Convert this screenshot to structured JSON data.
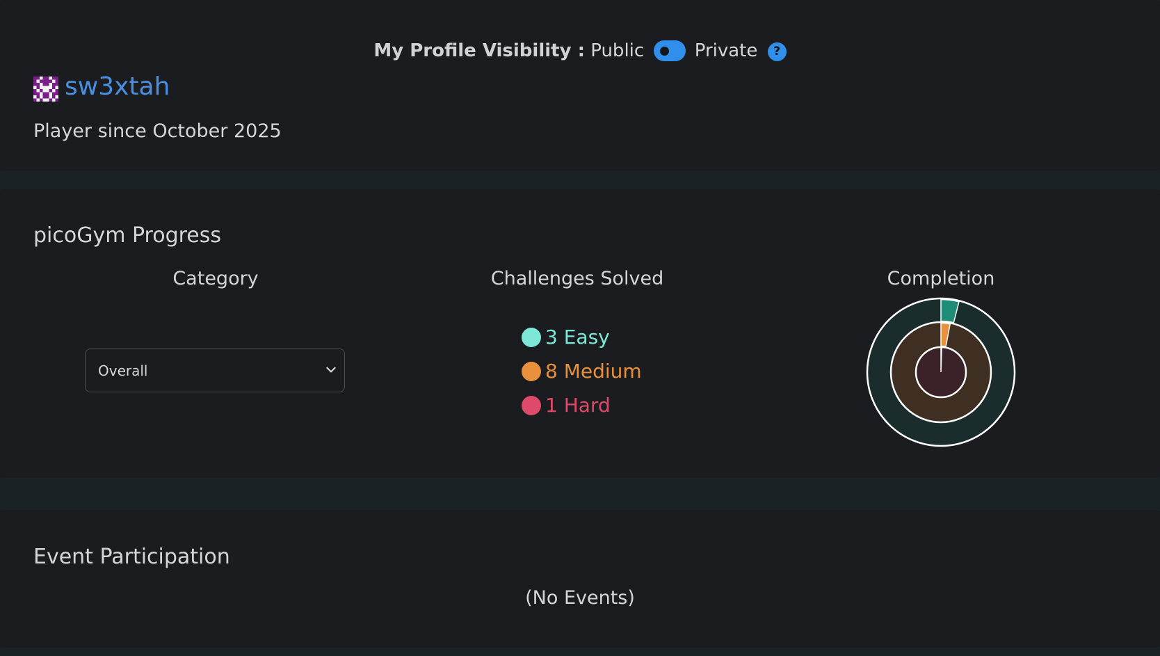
{
  "profile": {
    "visibility_label": "My Profile Visibility :",
    "public_label": "Public",
    "private_label": "Private",
    "help_glyph": "?",
    "toggle_state": "public",
    "username": "sw3xtah",
    "player_since": "Player since October 2025",
    "avatar_icon": "pixel-avatar-icon"
  },
  "progress": {
    "title": "picoGym Progress",
    "category_header": "Category",
    "solved_header": "Challenges Solved",
    "completion_header": "Completion",
    "category_selected": "Overall",
    "solved": [
      {
        "count": "3",
        "label": "Easy",
        "text": "3 Easy",
        "color": "#7ee8d8"
      },
      {
        "count": "8",
        "label": "Medium",
        "text": "8 Medium",
        "color": "#e8903c"
      },
      {
        "count": "1",
        "label": "Hard",
        "text": "1 Hard",
        "color": "#e04a6a"
      }
    ]
  },
  "chart_data": {
    "type": "pie",
    "rings": [
      {
        "name": "Hard",
        "completion": 0.005,
        "fill": "#e04a6a",
        "track": "#3b2228"
      },
      {
        "name": "Medium",
        "completion": 0.03,
        "fill": "#e8903c",
        "track": "#3e2f22"
      },
      {
        "name": "Easy",
        "completion": 0.04,
        "fill": "#1e8c77",
        "track": "#1b2c2c"
      }
    ]
  },
  "events": {
    "title": "Event Participation",
    "empty_text": "(No Events)"
  },
  "colors": {
    "accent": "#2f8fea",
    "link": "#4a90e2",
    "card": "#1a1c1f",
    "page": "#1b2225"
  }
}
